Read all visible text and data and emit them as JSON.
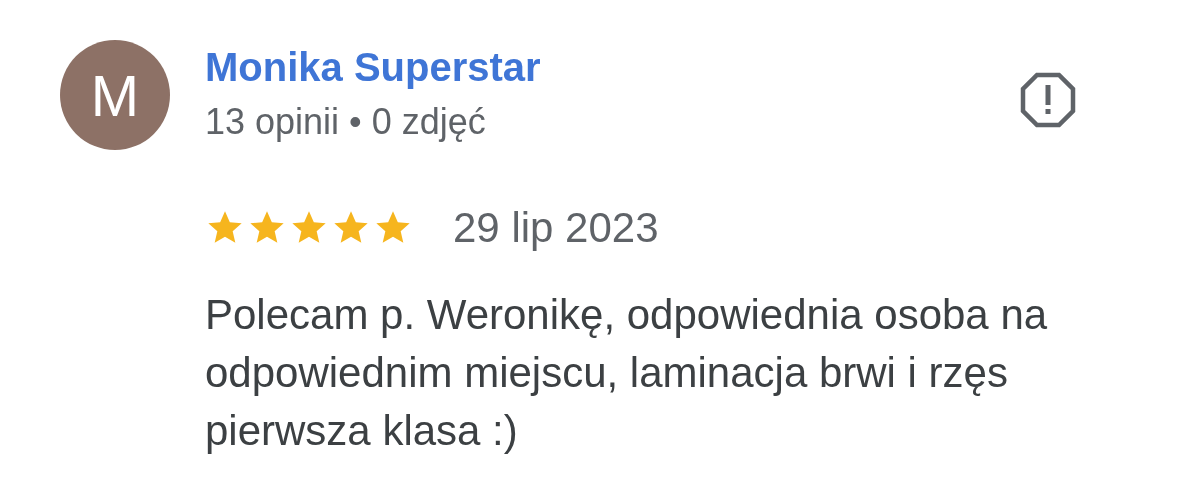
{
  "review": {
    "avatar_letter": "M",
    "author": "Monika Superstar",
    "meta": "13 opinii • 0 zdjęć",
    "stars": 5,
    "date": "29 lip 2023",
    "text": "Polecam p. Weronikę, odpowiednia osoba na odpowiednim miejscu, laminacja brwi i rzęs pierwsza klasa :)"
  }
}
